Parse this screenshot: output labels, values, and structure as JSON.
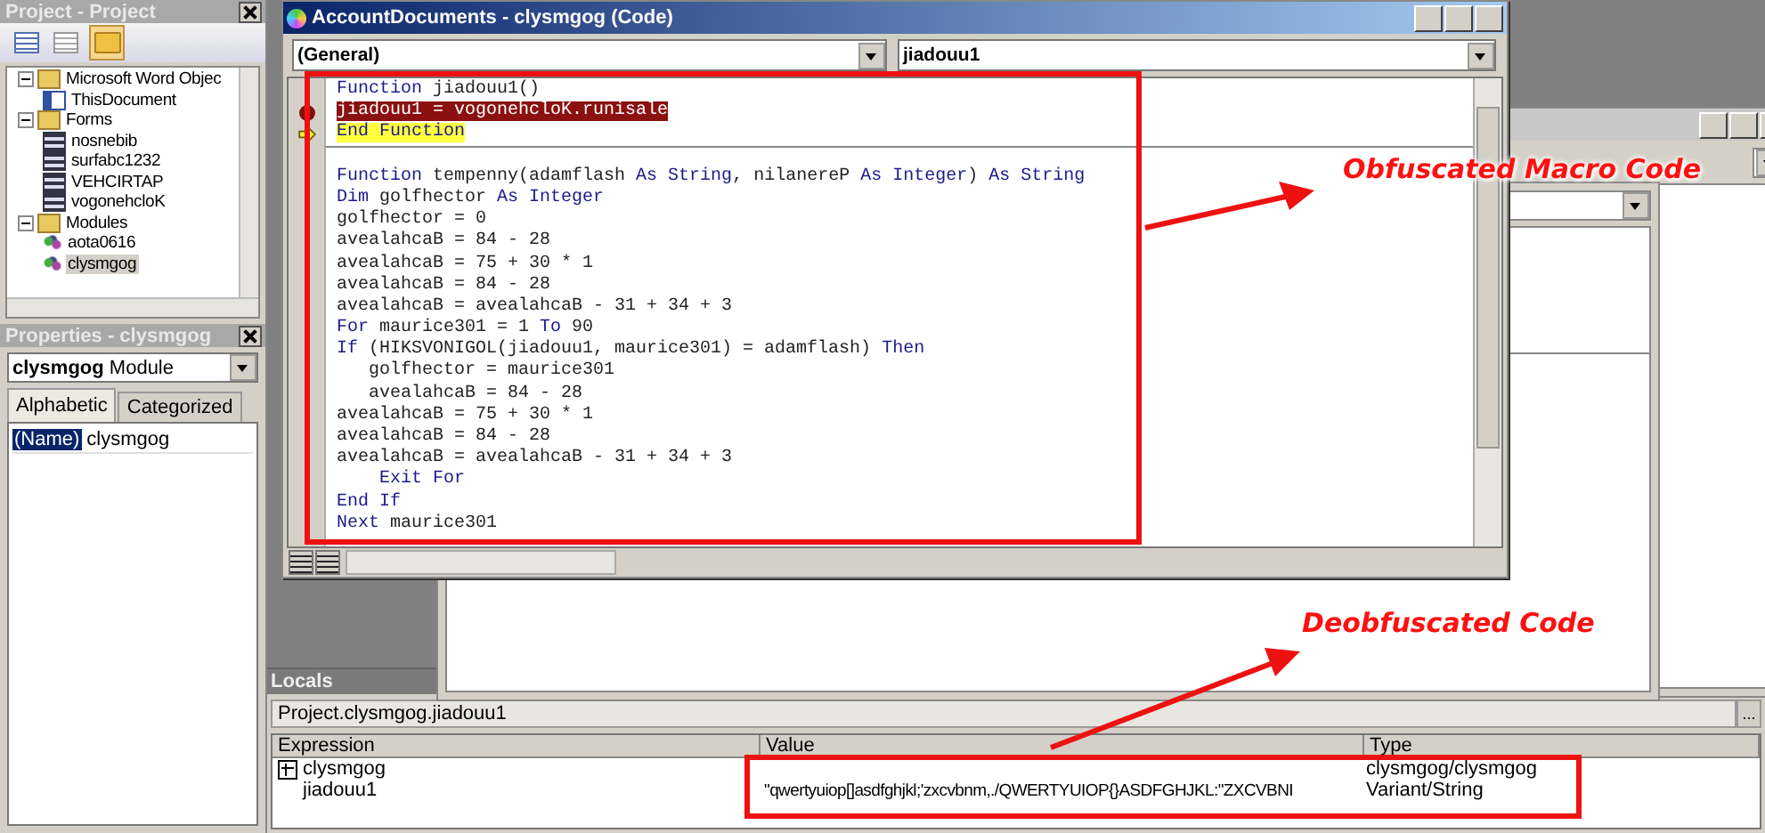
{
  "project_panel": {
    "title": "Project - Project",
    "tree": [
      {
        "label": "Microsoft Word Objec",
        "kind": "folder",
        "expanded": true,
        "selected": false,
        "children": [
          {
            "label": "ThisDocument",
            "kind": "document",
            "selected": false
          }
        ]
      },
      {
        "label": "Forms",
        "kind": "folder",
        "expanded": true,
        "selected": false,
        "children": [
          {
            "label": "nosnebib",
            "kind": "form",
            "selected": false
          },
          {
            "label": "surfabc1232",
            "kind": "form",
            "selected": false
          },
          {
            "label": "VEHCIRTAP",
            "kind": "form",
            "selected": false
          },
          {
            "label": "vogonehcloK",
            "kind": "form",
            "selected": false
          }
        ]
      },
      {
        "label": "Modules",
        "kind": "folder",
        "expanded": true,
        "selected": false,
        "children": [
          {
            "label": "aota0616",
            "kind": "module",
            "selected": false
          },
          {
            "label": "clysmgog",
            "kind": "module",
            "selected": true
          }
        ]
      }
    ]
  },
  "properties_panel": {
    "title": "Properties - clysmgog",
    "object": "**clysmgog** Module",
    "tabs": [
      {
        "label": "Alphabetic",
        "selected": true
      },
      {
        "label": "Categorized",
        "selected": false
      }
    ],
    "rows": [
      {
        "name": "(Name)",
        "value": "clysmgog",
        "selected": true
      }
    ]
  },
  "code_window": {
    "title": "AccountDocuments - clysmgog (Code)",
    "object_dropdown": "(General)",
    "procedure_dropdown": "jiadouu1",
    "procedures": [
      {
        "lines": [
          {
            "segments": [
              {
                "text": "Function",
                "keyword": true
              },
              {
                "text": " jiadouu1()",
                "keyword": false
              }
            ],
            "breakpoint": false,
            "current": false
          },
          {
            "segments": [
              {
                "text": "jiadouu1 = vogonehcloK.runisale",
                "keyword": false
              }
            ],
            "breakpoint": true,
            "current": false
          },
          {
            "segments": [
              {
                "text": "End Function",
                "keyword": true
              }
            ],
            "breakpoint": false,
            "current": true
          }
        ]
      },
      {
        "lines": [
          {
            "segments": [
              {
                "text": "Function",
                "keyword": true
              },
              {
                "text": " tempenny(adamflash ",
                "keyword": false
              },
              {
                "text": "As String",
                "keyword": true
              },
              {
                "text": ", nilanereP ",
                "keyword": false
              },
              {
                "text": "As Integer",
                "keyword": true
              },
              {
                "text": ") ",
                "keyword": false
              },
              {
                "text": "As String",
                "keyword": true
              }
            ],
            "breakpoint": false,
            "current": false
          },
          {
            "segments": [
              {
                "text": "Dim",
                "keyword": true
              },
              {
                "text": " golfhector ",
                "keyword": false
              },
              {
                "text": "As Integer",
                "keyword": true
              }
            ],
            "breakpoint": false,
            "current": false
          },
          {
            "segments": [
              {
                "text": "golfhector = 0",
                "keyword": false
              }
            ],
            "breakpoint": false,
            "current": false
          },
          {
            "segments": [
              {
                "text": "avealahcaB = 84 - 28",
                "keyword": false
              }
            ],
            "breakpoint": false,
            "current": false
          },
          {
            "segments": [
              {
                "text": "avealahcaB = 75 + 30 * 1",
                "keyword": false
              }
            ],
            "breakpoint": false,
            "current": false
          },
          {
            "segments": [
              {
                "text": "avealahcaB = 84 - 28",
                "keyword": false
              }
            ],
            "breakpoint": false,
            "current": false
          },
          {
            "segments": [
              {
                "text": "avealahcaB = avealahcaB - 31 + 34 + 3",
                "keyword": false
              }
            ],
            "breakpoint": false,
            "current": false
          },
          {
            "segments": [
              {
                "text": "For",
                "keyword": true
              },
              {
                "text": " maurice301 = 1 ",
                "keyword": false
              },
              {
                "text": "To",
                "keyword": true
              },
              {
                "text": " 90",
                "keyword": false
              }
            ],
            "breakpoint": false,
            "current": false
          },
          {
            "segments": [
              {
                "text": "If",
                "keyword": true
              },
              {
                "text": " (HIKSVONIGOL(jiadouu1, maurice301) = adamflash) ",
                "keyword": false
              },
              {
                "text": "Then",
                "keyword": true
              }
            ],
            "breakpoint": false,
            "current": false
          },
          {
            "segments": [
              {
                "text": "   golfhector = maurice301",
                "keyword": false
              }
            ],
            "breakpoint": false,
            "current": false
          },
          {
            "segments": [
              {
                "text": "   avealahcaB = 84 - 28",
                "keyword": false
              }
            ],
            "breakpoint": false,
            "current": false
          },
          {
            "segments": [
              {
                "text": "avealahcaB = 75 + 30 * 1",
                "keyword": false
              }
            ],
            "breakpoint": false,
            "current": false
          },
          {
            "segments": [
              {
                "text": "avealahcaB = 84 - 28",
                "keyword": false
              }
            ],
            "breakpoint": false,
            "current": false
          },
          {
            "segments": [
              {
                "text": "avealahcaB = avealahcaB - 31 + 34 + 3",
                "keyword": false
              }
            ],
            "breakpoint": false,
            "current": false
          },
          {
            "segments": [
              {
                "text": "    Exit For",
                "keyword": true
              }
            ],
            "breakpoint": false,
            "current": false
          },
          {
            "segments": [
              {
                "text": "End If",
                "keyword": true
              }
            ],
            "breakpoint": false,
            "current": false
          },
          {
            "segments": [
              {
                "text": "Next",
                "keyword": true
              },
              {
                "text": " maurice301",
                "keyword": false
              }
            ],
            "breakpoint": false,
            "current": false
          }
        ]
      }
    ]
  },
  "locals": {
    "title": "Locals",
    "context": "Project.clysmgog.jiadouu1",
    "context_button": "...",
    "columns": [
      "Expression",
      "Value",
      "Type"
    ],
    "rows": [
      {
        "expression": "clysmgog",
        "expandable": true,
        "type": "clysmgog/clysmgog"
      },
      {
        "expression": "jiadouu1",
        "expandable": false,
        "value": "\"qwertyuiop[]asdfghjkl;'zxcvbnm,./QWERTYUIOP{}ASDFGHJKL:\"ZXCVBNI",
        "type": "Variant/String"
      }
    ]
  },
  "annotations": [
    {
      "text": "Obfuscated Macro Code"
    },
    {
      "text": "Deobfuscated Code"
    }
  ]
}
